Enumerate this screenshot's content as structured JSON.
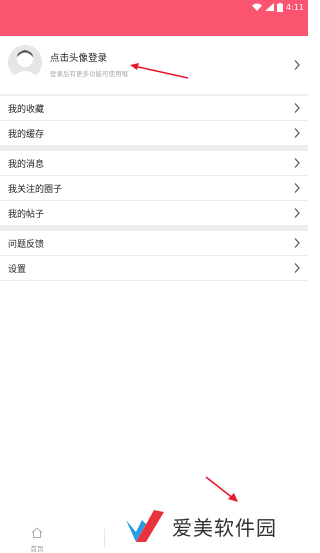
{
  "status_bar": {
    "time": "4:11"
  },
  "profile": {
    "title": "点击头像登录",
    "subtitle": "登录后有更多功能可使用哦"
  },
  "menu_groups": [
    {
      "items": [
        {
          "label": "我的收藏"
        },
        {
          "label": "我的缓存"
        }
      ]
    },
    {
      "items": [
        {
          "label": "我的消息"
        },
        {
          "label": "我关注的圈子"
        },
        {
          "label": "我的帖子"
        }
      ]
    },
    {
      "items": [
        {
          "label": "问题反馈"
        },
        {
          "label": "设置"
        }
      ]
    }
  ],
  "bottom_nav": {
    "home_label": "首页"
  },
  "watermark": {
    "text": "爱美软件园"
  },
  "colors": {
    "accent": "#fb5470",
    "annotation": "#e8162b"
  }
}
